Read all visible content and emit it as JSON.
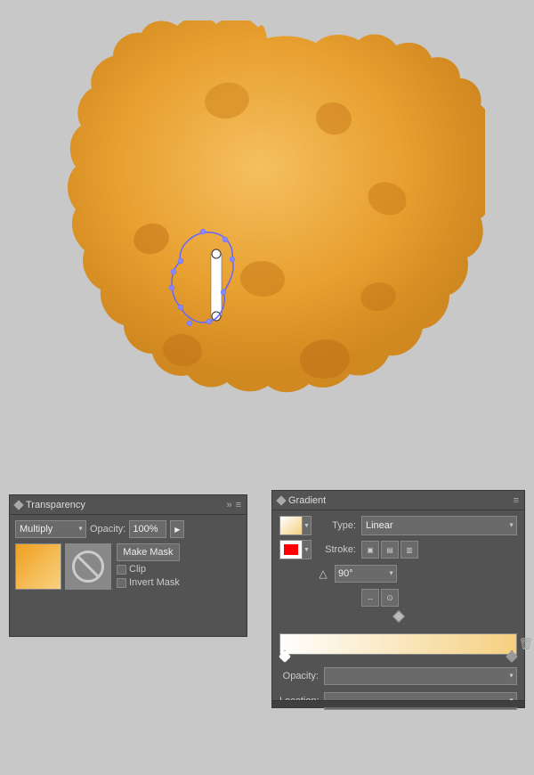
{
  "canvas": {
    "background": "#c8c8c8"
  },
  "transparency_panel": {
    "title": "Transparency",
    "blend_mode": "Multiply",
    "opacity_label": "Opacity:",
    "opacity_value": "100%",
    "make_mask_btn": "Make Mask",
    "clip_label": "Clip",
    "invert_mask_label": "Invert Mask"
  },
  "gradient_panel": {
    "title": "Gradient",
    "type_label": "Type:",
    "type_value": "Linear",
    "stroke_label": "Stroke:",
    "angle_label": "",
    "angle_value": "90°",
    "opacity_label": "Opacity:",
    "location_label": "Location:"
  }
}
